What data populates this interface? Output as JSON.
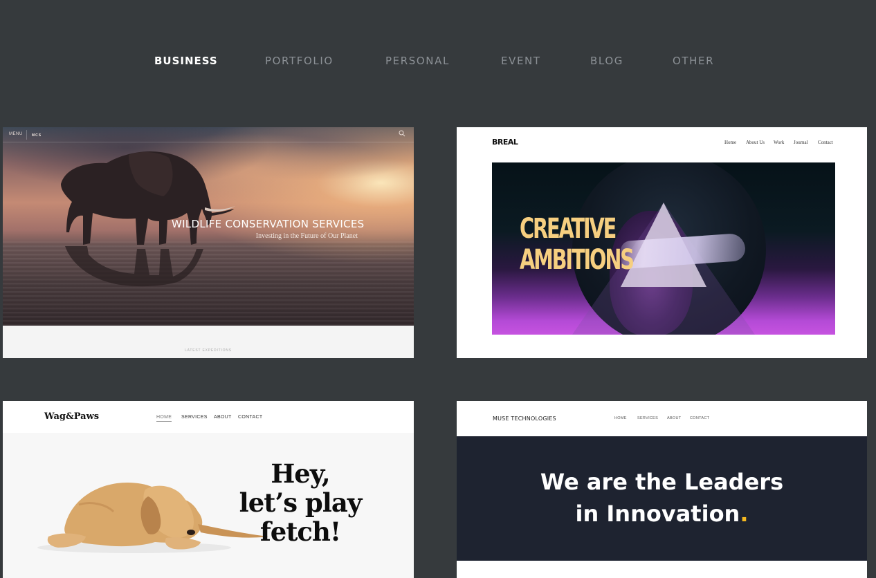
{
  "tabs": [
    {
      "label": "BUSINESS",
      "active": true
    },
    {
      "label": "PORTFOLIO",
      "active": false
    },
    {
      "label": "PERSONAL",
      "active": false
    },
    {
      "label": "EVENT",
      "active": false
    },
    {
      "label": "BLOG",
      "active": false
    },
    {
      "label": "OTHER",
      "active": false
    }
  ],
  "templates": {
    "wildlife": {
      "menu": "MENU",
      "logo": "MCS",
      "title": "WILDLIFE CONSERVATION SERVICES",
      "subtitle": "Investing in the Future of Our Planet",
      "section_label": "LATEST EXPEDITIONS",
      "search_icon": "search-icon"
    },
    "breal": {
      "logo": "BREAL",
      "nav": [
        "Home",
        "About Us",
        "Work",
        "Journal",
        "Contact"
      ],
      "headline_line1": "CREATIVE",
      "headline_line2": "AMBITIONS",
      "accent": "#f6cf80"
    },
    "wagpaws": {
      "logo": "Wag&Paws",
      "nav": [
        "HOME",
        "SERVICES",
        "ABOUT",
        "CONTACT"
      ],
      "headline_line1": "Hey,",
      "headline_line2": "let’s play",
      "headline_line3": "fetch!"
    },
    "muse": {
      "logo": "MUSE TECHNOLOGIES",
      "nav": [
        "HOME",
        "SERVICES",
        "ABOUT",
        "CONTACT"
      ],
      "headline_line1": "We are the Leaders",
      "headline_line2": "in Innovation",
      "headline_dot": ".",
      "accent": "#f5b820"
    }
  },
  "colors": {
    "background": "#363a3d",
    "tab_active": "#ffffff",
    "tab_inactive": "#8c9196"
  }
}
